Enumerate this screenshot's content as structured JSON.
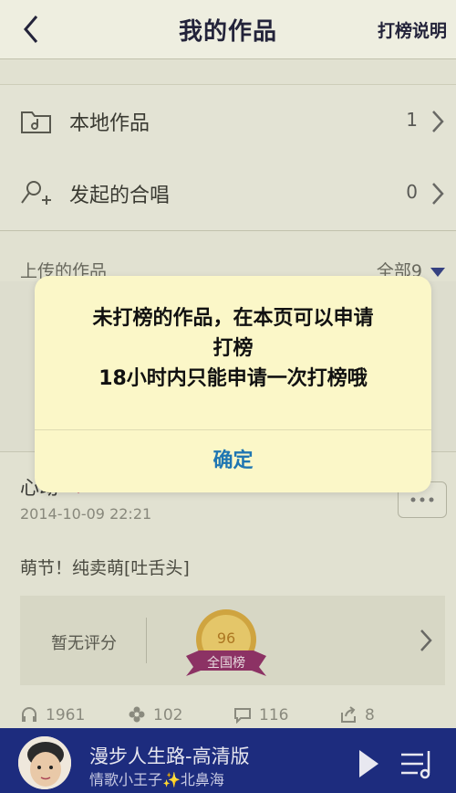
{
  "header": {
    "title": "我的作品",
    "right_action": "打榜说明"
  },
  "rows": [
    {
      "label": "本地作品",
      "count": "1"
    },
    {
      "label": "发起的合唱",
      "count": "0"
    }
  ],
  "uploads": {
    "header": "上传的作品",
    "filter": "全部9"
  },
  "work2": {
    "title": "心动",
    "date": "2014-10-09  22:21",
    "caption": "萌节！纯卖萌[吐舌头]",
    "no_score": "暂无评分",
    "medal_score": "96",
    "medal_label": "全国榜",
    "stats": {
      "listens": "1961",
      "flowers": "102",
      "comments": "116",
      "shares": "8"
    }
  },
  "player": {
    "title": "漫步人生路-高清版",
    "artist": "情歌小王子✨北鼻海"
  },
  "dialog": {
    "message_line1": "未打榜的作品，在本页可以申请",
    "message_line2": "打榜",
    "message_line3": "18小时内只能申请一次打榜哦",
    "confirm": "确定"
  }
}
